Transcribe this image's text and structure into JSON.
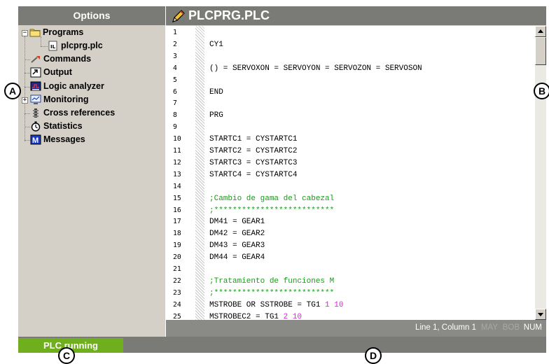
{
  "left_panel": {
    "title": "Options",
    "items": [
      {
        "label": "Programs",
        "icon": "folder-icon"
      },
      {
        "label": "plcprg.plc",
        "icon": "plc-file-icon"
      },
      {
        "label": "Commands",
        "icon": "commands-icon"
      },
      {
        "label": "Output",
        "icon": "output-icon"
      },
      {
        "label": "Logic analyzer",
        "icon": "logic-analyzer-icon"
      },
      {
        "label": "Monitoring",
        "icon": "monitoring-icon"
      },
      {
        "label": "Cross references",
        "icon": "cross-references-icon"
      },
      {
        "label": "Statistics",
        "icon": "statistics-icon"
      },
      {
        "label": "Messages",
        "icon": "messages-icon"
      }
    ]
  },
  "editor": {
    "title": "PLCPRG.PLC",
    "lines": [
      {
        "n": "1",
        "text": ""
      },
      {
        "n": "2",
        "text": "CY1"
      },
      {
        "n": "3",
        "text": ""
      },
      {
        "n": "4",
        "text": "() = SERVOXON = SERVOYON = SERVOZON = SERVOSON"
      },
      {
        "n": "5",
        "text": ""
      },
      {
        "n": "6",
        "text": "END"
      },
      {
        "n": "7",
        "text": ""
      },
      {
        "n": "8",
        "text": "PRG"
      },
      {
        "n": "9",
        "text": ""
      },
      {
        "n": "10",
        "text": "STARTC1 = CYSTARTC1"
      },
      {
        "n": "11",
        "text": "STARTC2 = CYSTARTC2"
      },
      {
        "n": "12",
        "text": "STARTC3 = CYSTARTC3"
      },
      {
        "n": "13",
        "text": "STARTC4 = CYSTARTC4"
      },
      {
        "n": "14",
        "text": ""
      },
      {
        "n": "15",
        "text": ";Cambio de gama del cabezal",
        "comment": true
      },
      {
        "n": "16",
        "text": ";**************************",
        "comment": true
      },
      {
        "n": "17",
        "text": "DM41 = GEAR1"
      },
      {
        "n": "18",
        "text": "DM42 = GEAR2"
      },
      {
        "n": "19",
        "text": "DM43 = GEAR3"
      },
      {
        "n": "20",
        "text": "DM44 = GEAR4"
      },
      {
        "n": "21",
        "text": ""
      },
      {
        "n": "22",
        "text": ";Tratamiento de funciones M",
        "comment": true
      },
      {
        "n": "23",
        "text": ";**************************",
        "comment": true
      },
      {
        "n": "24",
        "text": "MSTROBE OR SSTROBE = TG1 ",
        "tail": "1 10"
      },
      {
        "n": "25",
        "text": "MSTROBEC2 = TG1 ",
        "tail": "2 10"
      }
    ],
    "status": {
      "cursor": "Line 1, Column 1",
      "may": "MAY",
      "bob": "BOB",
      "num": "NUM"
    }
  },
  "statusbar": {
    "plc_state": "PLC running"
  },
  "callouts": {
    "a": "A",
    "b": "B",
    "c": "C",
    "d": "D"
  },
  "colors": {
    "header": "#7a7a76",
    "panel": "#d4d0c8",
    "comment": "#1a9a1a",
    "number": "#e020e0",
    "running": "#6fae1c"
  }
}
